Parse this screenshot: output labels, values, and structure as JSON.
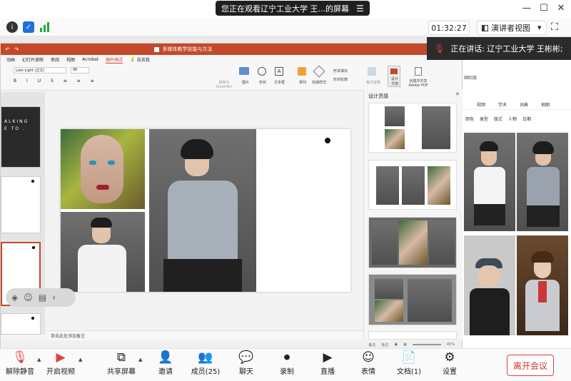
{
  "banner": {
    "text": "您正在观看辽宁工业大学 王...的屏幕",
    "menu_icon": "hamburger-icon"
  },
  "window_controls": {
    "minimize": "—",
    "maximize": "☐",
    "close": "✕"
  },
  "meeting": {
    "timer": "01:32:27",
    "view_button": "演讲者视图",
    "speaker_text": "正在讲话: 辽宁工业大学 王彬彬;"
  },
  "ppt": {
    "title": "多媒体教学技能与方法",
    "tabs": [
      "动画",
      "幻灯片放映",
      "审阅",
      "视图",
      "Acrobat",
      "图片格式",
      "告诉我"
    ],
    "active_tab": "图片格式",
    "ribbon": {
      "font": "Lato Light (正文)",
      "size": "96",
      "labels": [
        "转换为 SmartArt",
        "图片",
        "形状",
        "文本框",
        "排列",
        "快速样式",
        "形状填充",
        "形状轮廓",
        "格式窗格",
        "设计 灵感",
        "创建并共享 Adobe PDF"
      ]
    },
    "notes_placeholder": "单击此处添加备注",
    "status": {
      "notes": "备注",
      "comments": "批注",
      "zoom": "45%"
    },
    "design_panel_title": "设计灵感",
    "design_close": "✕",
    "slide_text": "ALKING E TO ."
  },
  "browser": {
    "partial_text": "国际版",
    "nav": [
      "视频",
      "学术",
      "词典",
      "地图"
    ],
    "filters": [
      "颜色",
      "类型",
      "版式",
      "人物",
      "日期"
    ]
  },
  "toolbar": {
    "items": [
      {
        "label": "解除静音",
        "icon": "mic-muted-icon"
      },
      {
        "label": "开启视频",
        "icon": "video-off-icon"
      },
      {
        "label": "共享屏幕",
        "icon": "share-screen-icon"
      },
      {
        "label": "邀请",
        "icon": "invite-icon"
      },
      {
        "label": "成员(25)",
        "icon": "members-icon"
      },
      {
        "label": "聊天",
        "icon": "chat-icon"
      },
      {
        "label": "录制",
        "icon": "record-icon"
      },
      {
        "label": "直播",
        "icon": "live-icon"
      },
      {
        "label": "表情",
        "icon": "emoji-icon"
      },
      {
        "label": "文档(1)",
        "icon": "document-icon"
      },
      {
        "label": "设置",
        "icon": "settings-icon"
      }
    ],
    "leave": "离开会议"
  },
  "colors": {
    "ppt_accent": "#c4482a",
    "leave_red": "#d83030",
    "icon_blue": "#1e6fe0",
    "icon_green": "#22a845"
  }
}
